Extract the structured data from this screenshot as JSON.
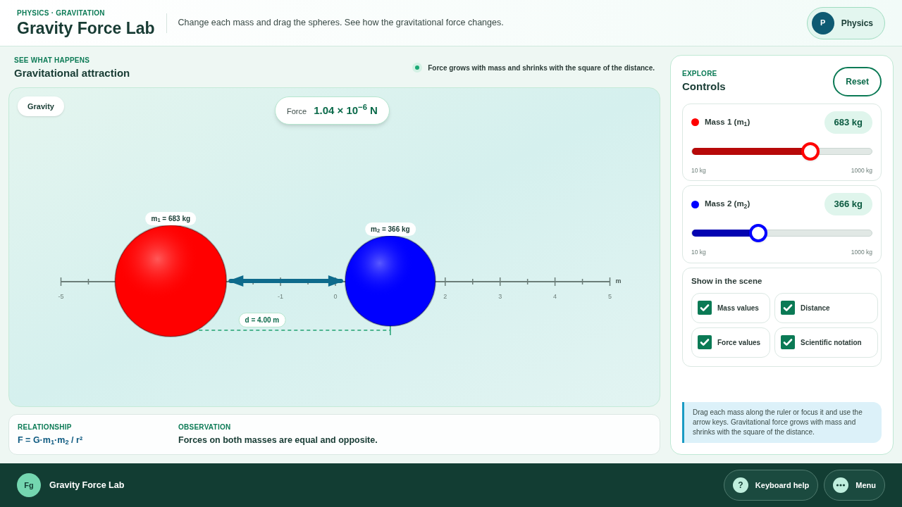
{
  "header": {
    "eyebrow": "PHYSICS · GRAVITATION",
    "title": "Gravity Force Lab",
    "subtitle": "Change each mass and drag the spheres. See how the gravitational force changes.",
    "subject": {
      "avatar": "P",
      "label": "Physics"
    }
  },
  "scene_header": {
    "eyebrow": "SEE WHAT HAPPENS",
    "title": "Gravitational attraction",
    "hint": "Force grows with mass and shrinks with the square of the distance."
  },
  "scene": {
    "tag": "Gravity",
    "force_label": "Force",
    "force_value": "1.04 × 10$^{−6}$ N",
    "distance_label": "d = 4.00 m",
    "unit": "m",
    "ruler_labels": [
      "-5",
      "-1",
      "0",
      "2",
      "3",
      "4",
      "5"
    ],
    "spheres": [
      {
        "label": "m$_{1}$ = 683 kg",
        "color": "#ff0000"
      },
      {
        "label": "m$_{2}$ = 366 kg",
        "color": "#0000ff"
      }
    ]
  },
  "summary": {
    "relationship_label": "RELATIONSHIP",
    "relationship": "F = G·m$_{1}$·m$_{2}$ / r²",
    "observation_label": "OBSERVATION",
    "observation": "Forces on both masses are equal and opposite."
  },
  "controls": {
    "eyebrow": "EXPLORE",
    "title": "Controls",
    "reset": "Reset",
    "masses": [
      {
        "name": "Mass 1 (m$_{1}$)",
        "value": "683 kg",
        "color": "#ff0000",
        "level": 0.66,
        "min": "10 kg",
        "max": "1000 kg"
      },
      {
        "name": "Mass 2 (m$_{2}$)",
        "value": "366 kg",
        "color": "#0000ff",
        "level": 0.37,
        "min": "10 kg",
        "max": "1000 kg"
      }
    ],
    "show_title": "Show in the scene",
    "options": [
      {
        "label": "Mass values",
        "checked": true
      },
      {
        "label": "Distance",
        "checked": true
      },
      {
        "label": "Force values",
        "checked": true
      },
      {
        "label": "Scientific notation",
        "checked": true
      }
    ],
    "help": "Drag each mass along the ruler or focus it and use the arrow keys. Gravitational force grows with mass and shrinks with the square of the distance."
  },
  "footer": {
    "badge": "Fg",
    "title": "Gravity Force Lab",
    "buttons": [
      {
        "kind": "help",
        "icon": "?",
        "label": "Keyboard help"
      },
      {
        "kind": "menu",
        "label": "Menu"
      }
    ]
  }
}
